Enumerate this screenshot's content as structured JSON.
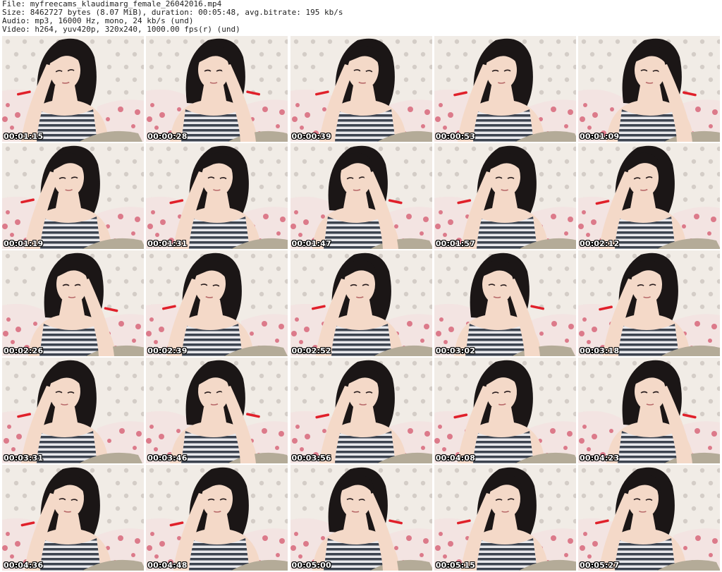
{
  "header": {
    "file_line": "File: myfreecams_klaudimarg_female_26042016.mp4",
    "size_line": "Size: 8462727 bytes (8.07 MiB), duration: 00:05:48, avg.bitrate: 195 kb/s",
    "audio_line": "Audio: mp3, 16000 Hz, mono, 24 kb/s (und)",
    "video_line": "Video: h264, yuv420p, 320x240, 1000.00 fps(r) (und)"
  },
  "palette": {
    "wall": "#f1ece6",
    "wall_dot": "#c9c3bc",
    "bedsheet": "#f3e4e2",
    "flower": "#d65f74",
    "hair": "#1b1616",
    "skin": "#f4d9c8",
    "top_stripe_dark": "#3d4450",
    "top_stripe_light": "#e8e8ec",
    "pants": "#b4ab98",
    "wristband": "#e0202a"
  },
  "thumbnails": [
    {
      "timestamp": "00:01:15"
    },
    {
      "timestamp": "00:00:28"
    },
    {
      "timestamp": "00:00:39"
    },
    {
      "timestamp": "00:00:53"
    },
    {
      "timestamp": "00:01:09"
    },
    {
      "timestamp": "00:01:19"
    },
    {
      "timestamp": "00:01:31"
    },
    {
      "timestamp": "00:01:47"
    },
    {
      "timestamp": "00:01:57"
    },
    {
      "timestamp": "00:02:12"
    },
    {
      "timestamp": "00:02:26"
    },
    {
      "timestamp": "00:02:39"
    },
    {
      "timestamp": "00:02:52"
    },
    {
      "timestamp": "00:03:02"
    },
    {
      "timestamp": "00:03:18"
    },
    {
      "timestamp": "00:03:31"
    },
    {
      "timestamp": "00:03:46"
    },
    {
      "timestamp": "00:03:56"
    },
    {
      "timestamp": "00:04:08"
    },
    {
      "timestamp": "00:04:23"
    },
    {
      "timestamp": "00:04:36"
    },
    {
      "timestamp": "00:04:48"
    },
    {
      "timestamp": "00:05:00"
    },
    {
      "timestamp": "00:05:15"
    },
    {
      "timestamp": "00:05:27"
    }
  ]
}
